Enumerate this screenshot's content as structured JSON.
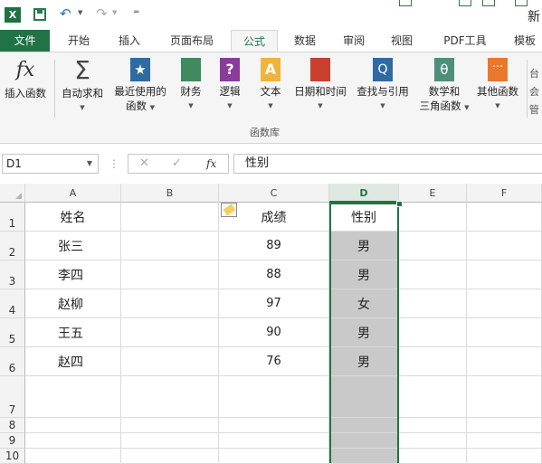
{
  "app": {
    "title_char": "新"
  },
  "tabs": [
    "文件",
    "开始",
    "插入",
    "页面布局",
    "公式",
    "数据",
    "审阅",
    "视图",
    "PDF工具",
    "模板"
  ],
  "active_tab": "公式",
  "ribbon": {
    "insert_function": "插入函数",
    "autosum": "自动求和",
    "recent_1": "最近使用的",
    "recent_2": "函数",
    "financial": "财务",
    "logical": "逻辑",
    "text": "文本",
    "datetime": "日期和时间",
    "lookup": "查找与引用",
    "math_1": "数学和",
    "math_2": "三角函数",
    "other": "其他函数",
    "edge_1": "台",
    "edge_2": "会",
    "edge_3": "管",
    "group_label": "函数库"
  },
  "icons": {
    "logical_glyph": "?",
    "text_glyph": "A",
    "lookup_glyph": "Q",
    "math_glyph": "θ",
    "other_glyph": "···",
    "fx_glyph": "fx",
    "sum_glyph": "Σ"
  },
  "formula_bar": {
    "name_box": "D1",
    "cancel": "✕",
    "enter": "✓",
    "fx": "fx",
    "content": "性别"
  },
  "columns": [
    "A",
    "B",
    "C",
    "D",
    "E",
    "F"
  ],
  "selected_column": "D",
  "rows": [
    "1",
    "2",
    "3",
    "4",
    "5",
    "6",
    "7",
    "8",
    "9",
    "10"
  ],
  "table": {
    "header": {
      "name": "姓名",
      "score": "成绩",
      "gender": "性别"
    },
    "records": [
      {
        "name": "张三",
        "score": "89",
        "gender": "男"
      },
      {
        "name": "李四",
        "score": "88",
        "gender": "男"
      },
      {
        "name": "赵柳",
        "score": "97",
        "gender": "女"
      },
      {
        "name": "王五",
        "score": "90",
        "gender": "男"
      },
      {
        "name": "赵四",
        "score": "76",
        "gender": "男"
      }
    ]
  },
  "colors": {
    "accent": "#217346",
    "selection_fill": "#c9c9c9"
  }
}
